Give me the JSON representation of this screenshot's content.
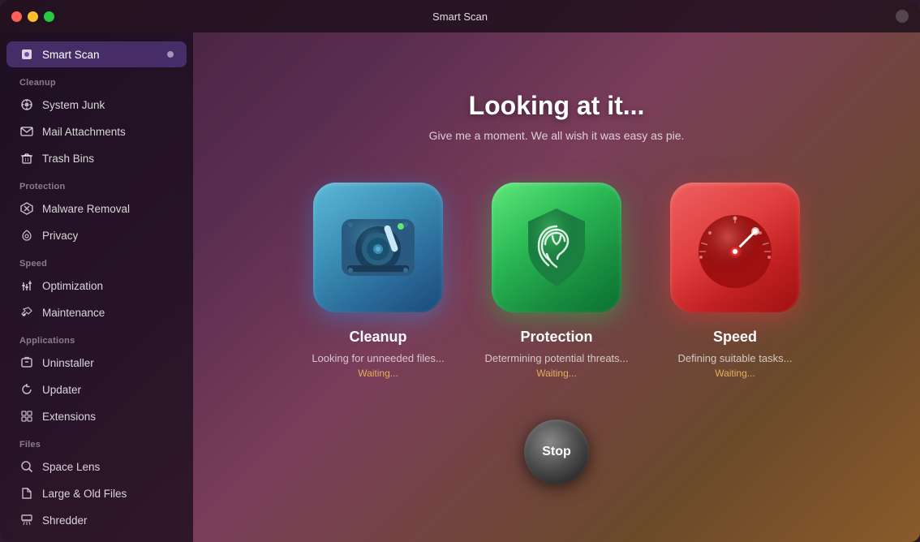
{
  "window": {
    "title": "Smart Scan"
  },
  "sidebar": {
    "active_item": "smart-scan",
    "smart_scan_label": "Smart Scan",
    "sections": [
      {
        "id": "cleanup",
        "label": "Cleanup",
        "items": [
          {
            "id": "system-junk",
            "label": "System Junk",
            "icon": "⚙"
          },
          {
            "id": "mail-attachments",
            "label": "Mail Attachments",
            "icon": "✉"
          },
          {
            "id": "trash-bins",
            "label": "Trash Bins",
            "icon": "🗑"
          }
        ]
      },
      {
        "id": "protection",
        "label": "Protection",
        "items": [
          {
            "id": "malware-removal",
            "label": "Malware Removal",
            "icon": "✦"
          },
          {
            "id": "privacy",
            "label": "Privacy",
            "icon": "✋"
          }
        ]
      },
      {
        "id": "speed",
        "label": "Speed",
        "items": [
          {
            "id": "optimization",
            "label": "Optimization",
            "icon": "⚡"
          },
          {
            "id": "maintenance",
            "label": "Maintenance",
            "icon": "🔧"
          }
        ]
      },
      {
        "id": "applications",
        "label": "Applications",
        "items": [
          {
            "id": "uninstaller",
            "label": "Uninstaller",
            "icon": "📦"
          },
          {
            "id": "updater",
            "label": "Updater",
            "icon": "↻"
          },
          {
            "id": "extensions",
            "label": "Extensions",
            "icon": "🧩"
          }
        ]
      },
      {
        "id": "files",
        "label": "Files",
        "items": [
          {
            "id": "space-lens",
            "label": "Space Lens",
            "icon": "◎"
          },
          {
            "id": "large-old-files",
            "label": "Large & Old Files",
            "icon": "📁"
          },
          {
            "id": "shredder",
            "label": "Shredder",
            "icon": "🗄"
          }
        ]
      }
    ]
  },
  "main": {
    "headline": "Looking at it...",
    "subtext": "Give me a moment. We all wish it was easy as pie.",
    "cards": [
      {
        "id": "cleanup",
        "name": "Cleanup",
        "status": "Looking for unneeded files...",
        "waiting": "Waiting..."
      },
      {
        "id": "protection",
        "name": "Protection",
        "status": "Determining potential threats...",
        "waiting": "Waiting..."
      },
      {
        "id": "speed",
        "name": "Speed",
        "status": "Defining suitable tasks...",
        "waiting": "Waiting..."
      }
    ],
    "stop_button_label": "Stop"
  }
}
